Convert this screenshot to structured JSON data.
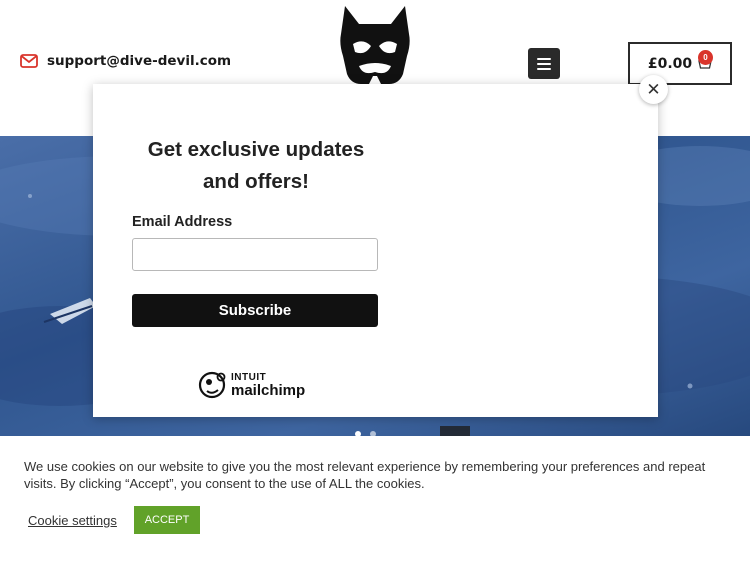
{
  "header": {
    "email": "support@dive-devil.com",
    "cart_total": "£0.00",
    "cart_count": "0",
    "logo_icon": "devil-mask-logo",
    "menu_icon": "hamburger-menu-icon",
    "cart_icon": "shopping-basket-icon",
    "email_icon": "envelope-icon"
  },
  "popup": {
    "title": "Get exclusive updates and offers!",
    "email_label": "Email Address",
    "email_value": "",
    "email_placeholder": "",
    "subscribe_label": "Subscribe",
    "close_symbol": "✕",
    "brand_top": "INTUIT",
    "brand_bottom": "mailchimp"
  },
  "cookie": {
    "text": "We use cookies on our website to give you the most relevant experience by remembering your preferences and repeat visits. By clicking “Accept”, you consent to the use of ALL the cookies.",
    "settings_label": "Cookie settings",
    "accept_label": "ACCEPT"
  },
  "colors": {
    "accent_red": "#d9342b",
    "accept_green": "#61a229",
    "hero_blue": "#30568f",
    "dark": "#111111"
  }
}
